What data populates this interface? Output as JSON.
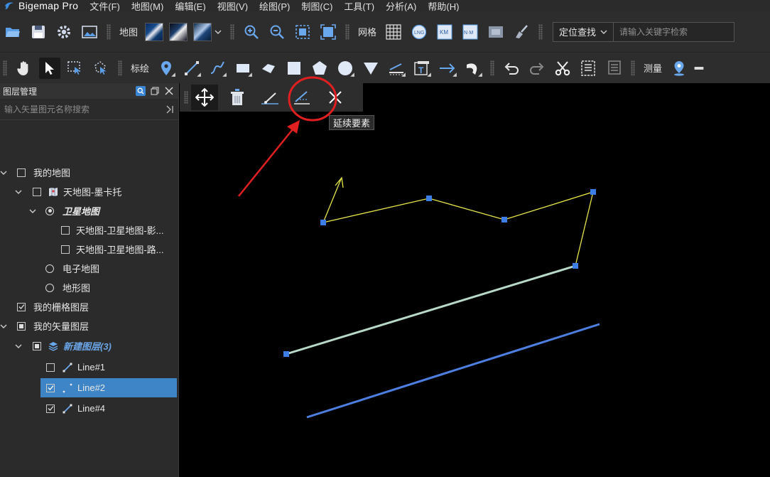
{
  "app": {
    "title": "Bigemap Pro"
  },
  "menu": [
    "文件(F)",
    "地图(M)",
    "编辑(E)",
    "视图(V)",
    "绘图(P)",
    "制图(C)",
    "工具(T)",
    "分析(A)",
    "帮助(H)"
  ],
  "toolbar1": {
    "map_label": "地图",
    "grid_label": "网格",
    "locate_label": "定位查找",
    "search_placeholder": "请输入关键字检索"
  },
  "toolbar2": {
    "mark_label": "标绘",
    "measure_label": "测量"
  },
  "panel": {
    "title": "图层管理",
    "search_placeholder": "输入矢量图元名称搜索",
    "tree": [
      {
        "label": "我的地图"
      },
      {
        "label": "天地图-墨卡托"
      },
      {
        "label": "卫星地图"
      },
      {
        "label": "天地图-卫星地图-影..."
      },
      {
        "label": "天地图-卫星地图-路..."
      },
      {
        "label": "电子地图"
      },
      {
        "label": "地形图"
      },
      {
        "label": "我的栅格图层"
      },
      {
        "label": "我的矢量图层"
      },
      {
        "label": "新建图层(3)"
      },
      {
        "label": "Line#1"
      },
      {
        "label": "Line#2"
      },
      {
        "label": "Line#4"
      }
    ]
  },
  "edit_toolbar": {
    "tooltip": "延续要素"
  },
  "colors": {
    "accent_blue": "#3d85c6",
    "highlight_red": "#e02020",
    "line_yellow": "#e6e64a",
    "line_green": "#b8d8c8",
    "line_blue": "#4d7fe0",
    "vertex_blue": "#3d7ee6"
  }
}
